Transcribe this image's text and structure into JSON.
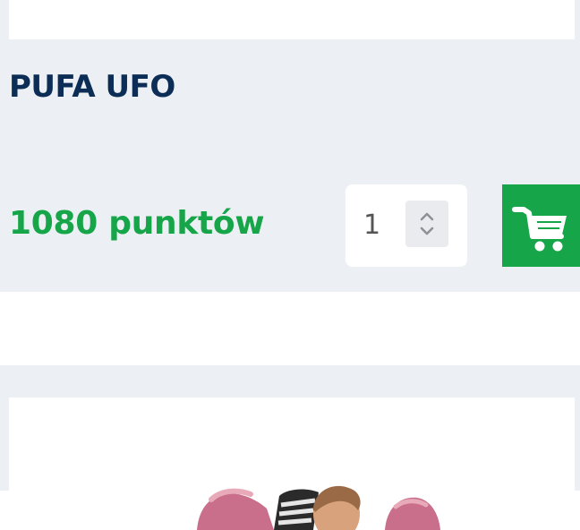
{
  "product": {
    "name": "PUFA UFO",
    "price_text": "1080 punktów"
  },
  "quantity": {
    "value": "1"
  },
  "colors": {
    "title": "#0c2d55",
    "price": "#16a548",
    "cart_button": "#16a548",
    "card_background": "#ecf0f4"
  },
  "icons": {
    "spinner": "up-down-arrows",
    "cart": "shopping-cart"
  }
}
